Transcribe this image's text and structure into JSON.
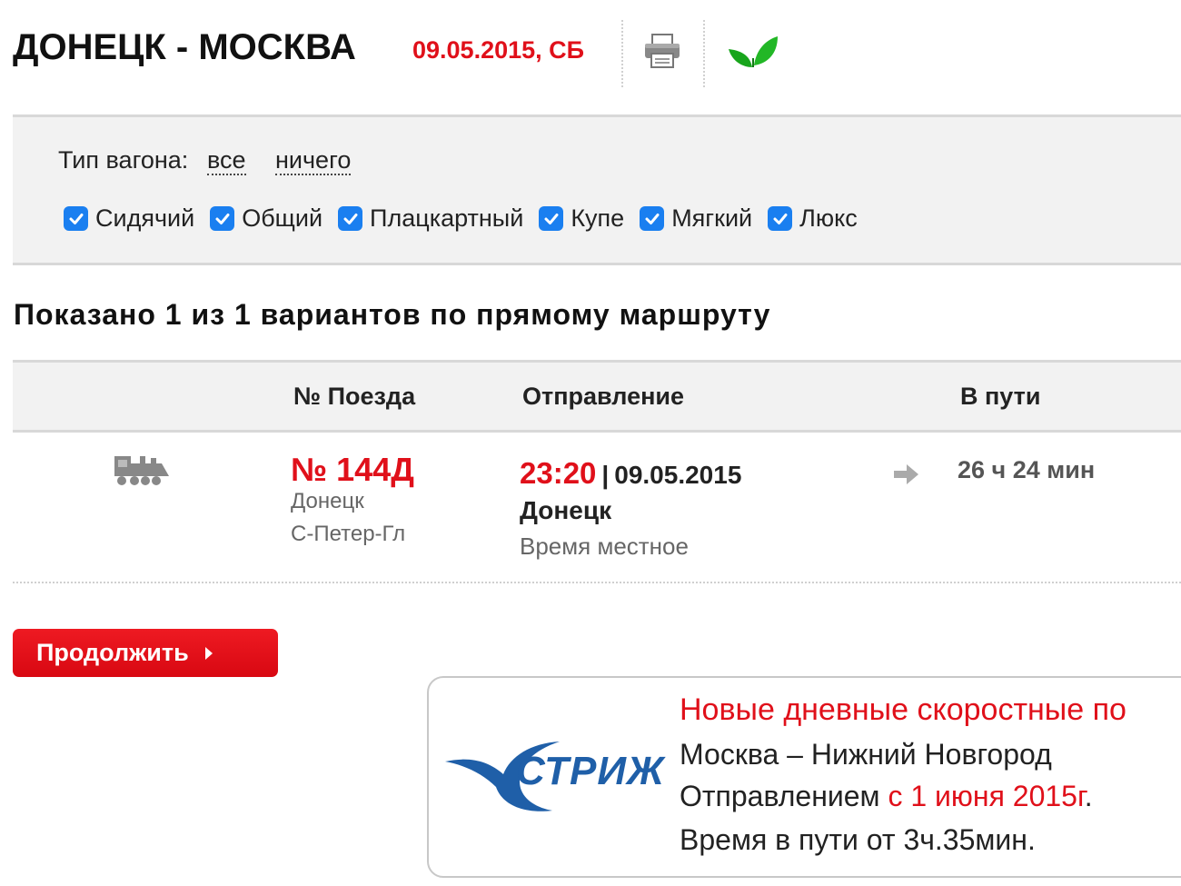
{
  "header": {
    "route": "ДОНЕЦК - МОСКВА",
    "date": "09.05.2015, СБ",
    "icons": [
      "print-icon",
      "leaf-icon"
    ]
  },
  "filters": {
    "wagon_type_label": "Тип вагона:",
    "select_all": "все",
    "select_none": "ничего",
    "options": [
      {
        "label": "Сидячий",
        "checked": true
      },
      {
        "label": "Общий",
        "checked": true
      },
      {
        "label": "Плацкартный",
        "checked": true
      },
      {
        "label": "Купе",
        "checked": true
      },
      {
        "label": "Мягкий",
        "checked": true
      },
      {
        "label": "Люкс",
        "checked": true
      }
    ]
  },
  "results": {
    "heading": "Показано 1 из 1 вариантов по прямому маршруту",
    "columns": {
      "train": "№ Поезда",
      "departure": "Отправление",
      "travel_time": "В пути"
    },
    "rows": [
      {
        "train_number": "№ 144Д",
        "from": "Донецк",
        "to": "С-Петер-Гл",
        "departure_time": "23:20",
        "separator": "|",
        "departure_date": "09.05.2015",
        "departure_station": "Донецк",
        "time_note": "Время местное",
        "travel_time": "26 ч 24 мин"
      }
    ]
  },
  "actions": {
    "continue": "Продолжить"
  },
  "ad": {
    "logo_text": "СТРИЖ",
    "headline": "Новые дневные скоростные по",
    "line1": "Москва – Нижний Новгород",
    "line2_prefix": "Отправлением ",
    "line2_highlight": "с 1 июня 2015г",
    "line2_suffix": ".",
    "line3": "Время в пути от 3ч.35мин."
  },
  "colors": {
    "accent_red": "#e0101a",
    "checkbox_blue": "#1a7ff0",
    "panel_gray": "#f2f2f2",
    "logo_blue": "#1f5fa8"
  }
}
